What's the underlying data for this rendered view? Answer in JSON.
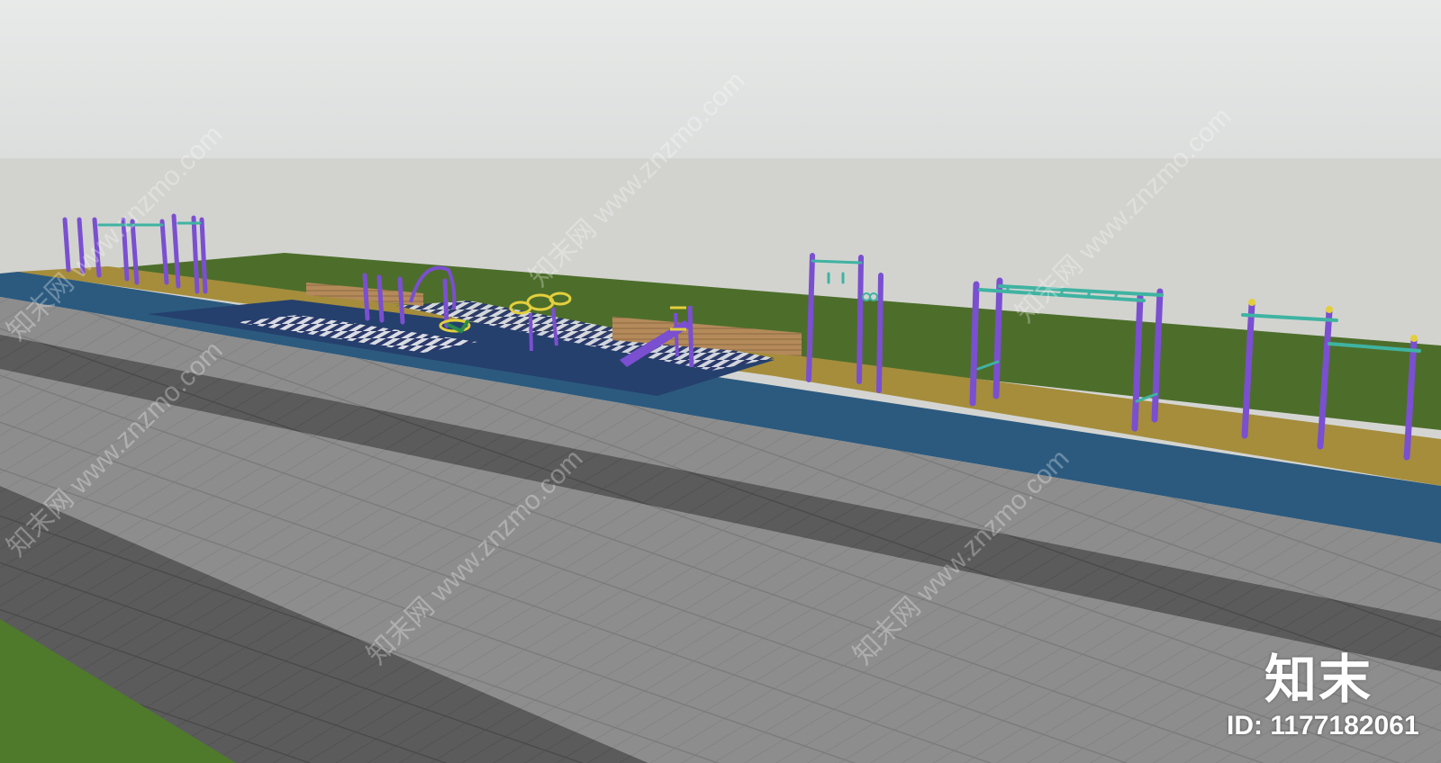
{
  "watermark": {
    "brand_text": "知末",
    "id_label": "ID: ",
    "id_value": "1177182061",
    "tiled_text": "知末网 www.znzmo.com"
  },
  "colors": {
    "sky_top": "#e7e9e8",
    "sky_bottom": "#d2d3cf",
    "lawn": "#4a6b2a",
    "sand_track": "#a89040",
    "blue_track": "#2b5a80",
    "pavement_light": "#8f8f8f",
    "pavement_dark": "#5c5c5c",
    "post_purple": "#7a4fd0",
    "bar_teal": "#3fb3a2",
    "accent_yellow": "#e3cf3c"
  },
  "scene": {
    "equipment": [
      "pull-up-frame-cluster",
      "arch-gate",
      "ring-spinner",
      "seesaw-ramp",
      "ring-frame",
      "monkey-bars",
      "parallel-bars"
    ]
  }
}
